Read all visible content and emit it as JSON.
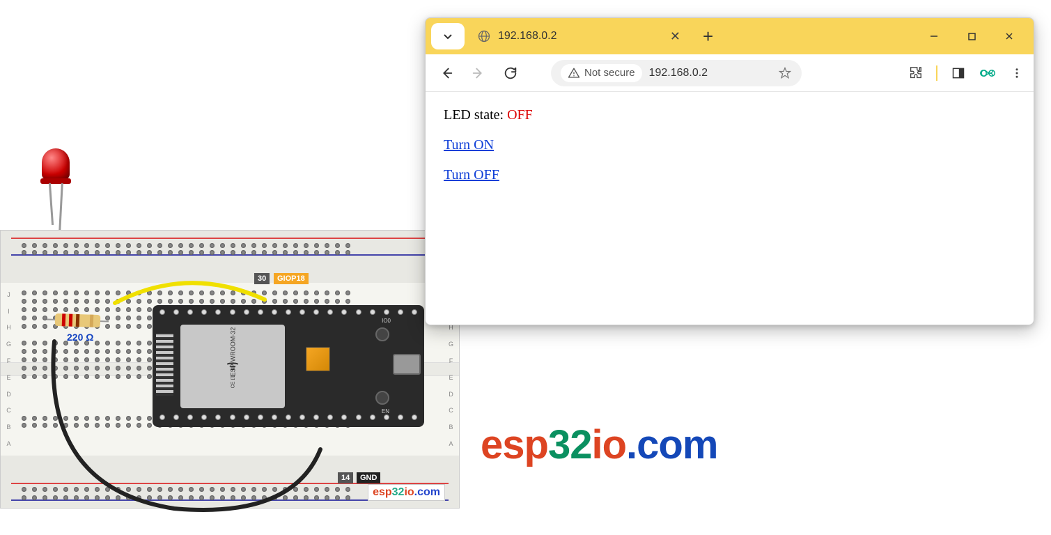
{
  "browser": {
    "tab_title": "192.168.0.2",
    "url": "192.168.0.2",
    "security_label": "Not secure"
  },
  "page": {
    "led_label": "LED state: ",
    "led_state": "OFF",
    "link_on": "Turn ON",
    "link_off": "Turn OFF"
  },
  "circuit": {
    "resistor_label": "220 Ω",
    "pin30": "30",
    "giop18": "GIOP18",
    "pin14": "14",
    "gnd": "GND",
    "chip_text_1": "ESP-WROOM-32",
    "chip_text_2": "FCC ID:2AC7Z-ESPWROOM32",
    "io0": "IO0",
    "en": "EN"
  },
  "logo": {
    "p1": "esp",
    "p2": "32",
    "p3": "io",
    "p4": ".com"
  }
}
